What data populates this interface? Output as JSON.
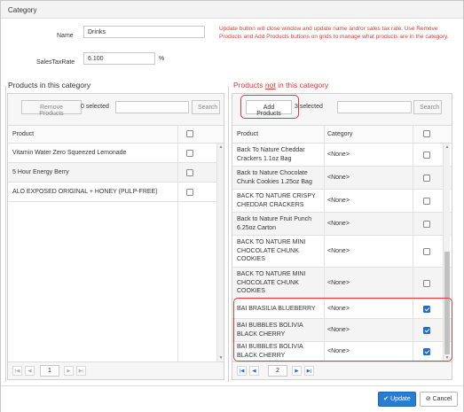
{
  "window": {
    "title": "Category"
  },
  "form": {
    "name_label": "Name",
    "name_value": "Drinks",
    "tax_label": "SalesTaxRate",
    "tax_value": "6.100",
    "tax_unit": "%"
  },
  "note": "Update button will close window and update name and/or sales tax rate. Use Remove Products and Add Products buttons on grids to manage what products are in the category.",
  "left": {
    "title": "Products in this category",
    "remove_label": "Remove Products",
    "selected_text": "0 selected",
    "search_label": "Search",
    "col_product": "Product",
    "rows": [
      {
        "product": "Vitamin Water Zero Squeezed Lemonade",
        "checked": false
      },
      {
        "product": "5 Hour Energy Berry",
        "checked": false
      },
      {
        "product": "ALO EXPOSED ORIGINAL + HONEY (PULP-FREE)",
        "checked": false
      }
    ],
    "page": "1"
  },
  "right": {
    "title_pre": "Products ",
    "title_not": "not",
    "title_post": " in this category",
    "add_label": "Add Products",
    "selected_text": "3 selected",
    "search_label": "Search",
    "col_product": "Product",
    "col_category": "Category",
    "rows": [
      {
        "product": "Back To Nature Cheddar Crackers 1.1oz Bag",
        "category": "<None>",
        "checked": false
      },
      {
        "product": "Back to Nature Chocolate Chunk Cookies 1.25oz Bag",
        "category": "<None>",
        "checked": false
      },
      {
        "product": "BACK TO NATURE CRISPY CHEDDAR CRACKERS",
        "category": "<None>",
        "checked": false
      },
      {
        "product": "Back to Nature Fruit Punch 6.25oz Carton",
        "category": "<None>",
        "checked": false
      },
      {
        "product": "BACK TO NATURE MINI CHOCOLATE CHUNK COOKIES",
        "category": "<None>",
        "checked": false
      },
      {
        "product": "BACK TO NATURE MINI CHOCOLATE CHUNK COOKIES",
        "category": "<None>",
        "checked": false
      },
      {
        "product": "BAI BRASILIA BLUEBERRY",
        "category": "<None>",
        "checked": true
      },
      {
        "product": "BAI BUBBLES BOLIVIA BLACK CHERRY",
        "category": "<None>",
        "checked": true
      },
      {
        "product": "BAI BUBBLES BOLIVIA BLACK CHERRY",
        "category": "<None>",
        "checked": true
      }
    ],
    "page": "2"
  },
  "footer": {
    "update_label": "Update",
    "cancel_label": "Cancel"
  },
  "colors": {
    "accent": "#2a7cd1",
    "checkbox": "#1d6ad8",
    "alert": "#e53935"
  },
  "icons": {
    "first": "first-page-icon",
    "prev": "prev-page-icon",
    "next": "next-page-icon",
    "last": "last-page-icon",
    "check": "check-icon",
    "cancel": "cancel-icon"
  }
}
